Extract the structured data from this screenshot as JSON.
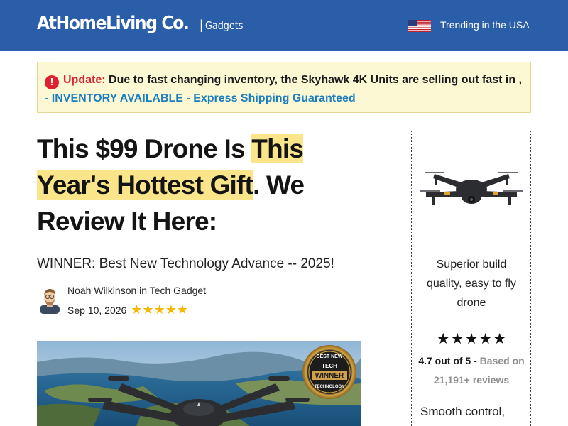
{
  "header": {
    "brand": "AtHomeLiving Co.",
    "separator": "|",
    "section": "Gadgets",
    "trending": "Trending in the USA",
    "flag_icon": "us-flag-icon",
    "bg_color": "#2a5ea8"
  },
  "update": {
    "icon": "alert-icon",
    "icon_glyph": "!",
    "label": "Update:",
    "text": " Due to fast changing inventory, the Skyhawk 4K Units are selling out fast in , ",
    "link": "- INVENTORY AVAILABLE - Express Shipping Guaranteed"
  },
  "article": {
    "headline_part1": "This $99 Drone Is ",
    "headline_highlight": "This Year's Hottest Gift",
    "headline_part2": ". We Review It Here:",
    "subhead": "WINNER: Best New Technology Advance -- 2025!",
    "byline": "Noah Wilkinson in Tech Gadget",
    "date": "Sep 10, 2026",
    "stars": "★★★★★",
    "rating_value": 5,
    "badge": {
      "line1": "BEST NEW",
      "line2": "TECH",
      "line3": "WINNER",
      "line4": "TECHNOLOGY"
    }
  },
  "sidebar": {
    "description": "Superior build quality, easy to fly drone",
    "stars": "★★★★★",
    "rating_bold": "4.7 out of 5 - ",
    "rating_gray": "Based on 21,191+ reviews",
    "rating_value": 4.7,
    "rating_max": 5,
    "smooth": "Smooth control,"
  },
  "colors": {
    "accent_blue": "#2a5ea8",
    "highlight": "#fbe58a",
    "alert_red": "#d9262f",
    "link_blue": "#1a7ec1",
    "star_gold": "#f5b700"
  }
}
